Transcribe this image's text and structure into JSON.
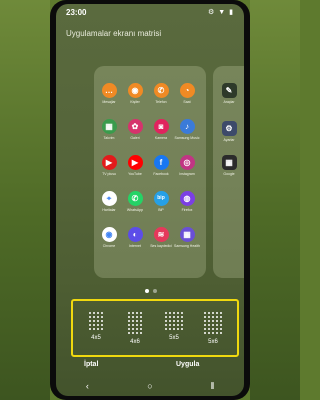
{
  "status_bar": {
    "time": "23:00",
    "icons": "⚙ ▼ ▮"
  },
  "page": {
    "title": "Uygulamalar ekranı matrisi"
  },
  "apps": [
    {
      "name": "Mesajlar",
      "icon": "messages-icon",
      "color": "#f08a24",
      "glyph": "…"
    },
    {
      "name": "Kişiler",
      "icon": "contacts-icon",
      "color": "#f08a24",
      "glyph": "◉"
    },
    {
      "name": "Telefon",
      "icon": "phone-icon",
      "color": "#f08a24",
      "glyph": "✆"
    },
    {
      "name": "Saat",
      "icon": "clock-icon",
      "color": "#f08a24",
      "glyph": "◔"
    },
    {
      "name": "Takvim",
      "icon": "calendar-icon",
      "color": "#3a9b4c",
      "glyph": "▦"
    },
    {
      "name": "Galeri",
      "icon": "gallery-icon",
      "color": "#d6336c",
      "glyph": "✿"
    },
    {
      "name": "Kamera",
      "icon": "camera-icon",
      "color": "#e0245e",
      "glyph": "◙"
    },
    {
      "name": "Samsung Music",
      "icon": "music-icon",
      "color": "#3b7bd8",
      "glyph": "♪"
    },
    {
      "name": "TV plusu",
      "icon": "tv-icon",
      "color": "#e21b1b",
      "glyph": "▶"
    },
    {
      "name": "YouTube",
      "icon": "youtube-icon",
      "color": "#ff0000",
      "glyph": "▶"
    },
    {
      "name": "Facebook",
      "icon": "facebook-icon",
      "color": "#1877f2",
      "glyph": "f"
    },
    {
      "name": "Instagram",
      "icon": "instagram-icon",
      "color": "#c13584",
      "glyph": "◎"
    },
    {
      "name": "Haritalar",
      "icon": "maps-icon",
      "color": "#ffffff",
      "glyph": "⌖"
    },
    {
      "name": "WhatsApp",
      "icon": "whatsapp-icon",
      "color": "#25d366",
      "glyph": "✆"
    },
    {
      "name": "BiP",
      "icon": "bip-icon",
      "color": "#26a0e6",
      "glyph": "bip"
    },
    {
      "name": "Firefox",
      "icon": "firefox-icon",
      "color": "#7b3fe4",
      "glyph": "◍"
    },
    {
      "name": "Chrome",
      "icon": "chrome-icon",
      "color": "#ffffff",
      "glyph": "◉"
    },
    {
      "name": "Internet",
      "icon": "internet-icon",
      "color": "#5c4de8",
      "glyph": "◐"
    },
    {
      "name": "Ses kaydedici",
      "icon": "recorder-icon",
      "color": "#e5395b",
      "glyph": "≋"
    },
    {
      "name": "Samsung Health",
      "icon": "apps-folder-icon",
      "color": "#6a4fd6",
      "glyph": "▦"
    }
  ],
  "side_apps": [
    {
      "name": "Araçlar",
      "icon": "tools-icon",
      "color": "#2e3a2a",
      "glyph": "✎"
    },
    {
      "name": "Ayarlar",
      "icon": "settings-icon",
      "color": "#3d4a6a",
      "glyph": "⚙"
    },
    {
      "name": "Google",
      "icon": "google-folder-icon",
      "color": "#2b2b2b",
      "glyph": "▦"
    }
  ],
  "grid_options": [
    {
      "label": "4x5",
      "cols": 4,
      "rows": 5
    },
    {
      "label": "4x6",
      "cols": 4,
      "rows": 6
    },
    {
      "label": "5x5",
      "cols": 5,
      "rows": 5
    },
    {
      "label": "5x6",
      "cols": 5,
      "rows": 6
    }
  ],
  "actions": {
    "cancel": "İptal",
    "apply": "Uygula"
  },
  "nav": {
    "back": "‹",
    "home": "○",
    "recents": "⦀"
  },
  "colors": {
    "highlight": "#f0d90f"
  }
}
